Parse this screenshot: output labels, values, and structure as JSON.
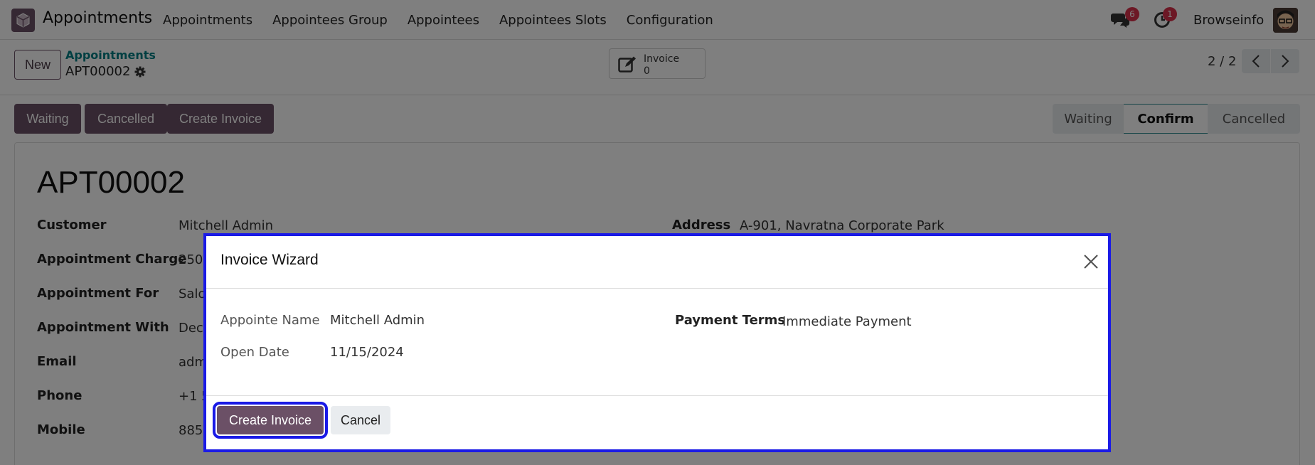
{
  "navbar": {
    "app_name": "Appointments",
    "menu": [
      "Appointments",
      "Appointees Group",
      "Appointees",
      "Appointees Slots",
      "Configuration"
    ],
    "chat_badge": "6",
    "activity_badge": "1",
    "company": "Browseinfo"
  },
  "control": {
    "new_label": "New",
    "breadcrumb_parent": "Appointments",
    "breadcrumb_current": "APT00002",
    "smart_button_label": "Invoice",
    "smart_button_count": "0",
    "pager": "2 / 2"
  },
  "statusbar": {
    "buttons": [
      "Waiting",
      "Cancelled",
      "Create Invoice"
    ],
    "stages": [
      "Waiting",
      "Confirm",
      "Cancelled"
    ],
    "active_stage": "Confirm"
  },
  "form": {
    "title": "APT00002",
    "fields": [
      {
        "label": "Customer",
        "value": "Mitchell Admin"
      },
      {
        "label": "Appointment Charge",
        "value": "250"
      },
      {
        "label": "Appointment For",
        "value": "Salo"
      },
      {
        "label": "Appointment With",
        "value": "Dec"
      },
      {
        "label": "Email",
        "value": "adm"
      },
      {
        "label": "Phone",
        "value": "+1 5"
      },
      {
        "label": "Mobile",
        "value": "885"
      }
    ],
    "address_label": "Address",
    "address_value": "A-901, Navratna Corporate Park"
  },
  "modal": {
    "title": "Invoice Wizard",
    "appointee_label": "Appointe Name",
    "appointee_value": "Mitchell Admin",
    "open_date_label": "Open Date",
    "open_date_value": "11/15/2024",
    "payment_terms_label": "Payment Terms",
    "payment_terms_value": "Immediate Payment",
    "primary_button": "Create Invoice",
    "secondary_button": "Cancel"
  },
  "colors": {
    "brand": "#6b5066",
    "highlight": "#1a1ae6",
    "teal": "#017e84",
    "badge": "#d9314a"
  }
}
